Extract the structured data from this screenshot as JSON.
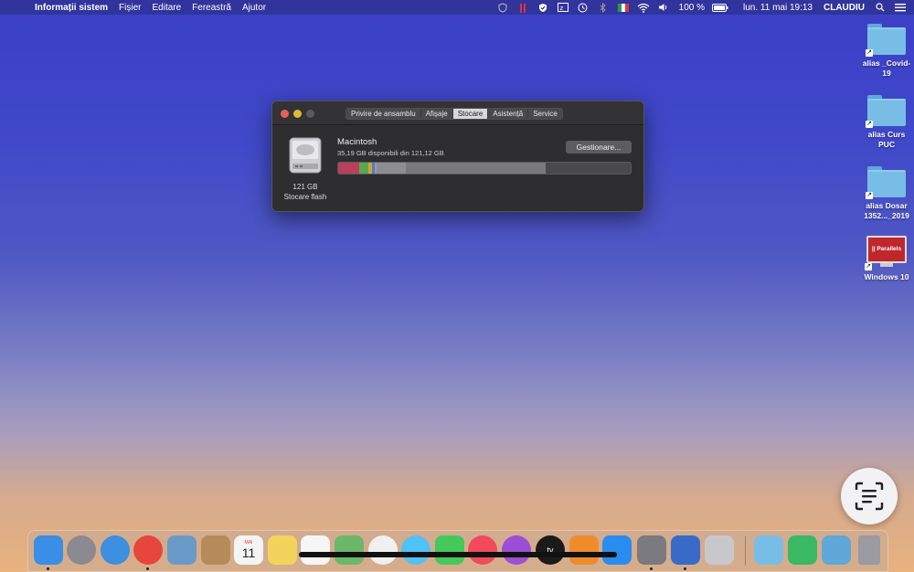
{
  "menubar": {
    "app_name": "Informații sistem",
    "items": [
      "Fișier",
      "Editare",
      "Fereastră",
      "Ajutor"
    ],
    "battery": "100 %",
    "datetime": "lun. 11 mai  19:13",
    "user": "CLAUDIU"
  },
  "window": {
    "tabs": [
      {
        "label": "Privire de ansamblu",
        "active": false
      },
      {
        "label": "Afișaje",
        "active": false
      },
      {
        "label": "Stocare",
        "active": true
      },
      {
        "label": "Asistență",
        "active": false
      },
      {
        "label": "Service",
        "active": false
      }
    ],
    "disk": {
      "name": "Macintosh",
      "free_text": "35,19 GB disponibili din 121,12 GB",
      "size": "121 GB",
      "type": "Stocare flash",
      "manage_label": "Gestionare..."
    },
    "storage_segments": [
      {
        "fraction": 0.072,
        "color": "#b8405e"
      },
      {
        "fraction": 0.032,
        "color": "#5aa84e"
      },
      {
        "fraction": 0.012,
        "color": "#d4a23c"
      },
      {
        "fraction": 0.008,
        "color": "#4d7fd4"
      },
      {
        "fraction": 0.006,
        "color": "#9a9a9c"
      },
      {
        "fraction": 0.1,
        "color": "#8e8e92"
      },
      {
        "fraction": 0.48,
        "color": "#7a7a7e"
      }
    ]
  },
  "desktop": {
    "items": [
      {
        "label": "alias _Covid-19",
        "type": "folder"
      },
      {
        "label": "alias Curs PUC",
        "type": "folder"
      },
      {
        "label": "alias Dosar 1352..._2019",
        "type": "folder"
      },
      {
        "label": "Windows 10",
        "type": "parallels",
        "badge": "|| Parallels"
      }
    ]
  },
  "dock": {
    "apps": [
      {
        "name": "finder",
        "color": "#3a8ee6"
      },
      {
        "name": "launchpad",
        "color": "#8a8a90"
      },
      {
        "name": "safari",
        "color": "#3d8fe0"
      },
      {
        "name": "chrome",
        "color": "#e8453c"
      },
      {
        "name": "preview",
        "color": "#6a9ac8"
      },
      {
        "name": "contacts",
        "color": "#b58b5a"
      },
      {
        "name": "calendar",
        "color": "#f4f4f4"
      },
      {
        "name": "notes",
        "color": "#f2d45c"
      },
      {
        "name": "reminders",
        "color": "#f6f6f6"
      },
      {
        "name": "maps",
        "color": "#6bb86a"
      },
      {
        "name": "photos",
        "color": "#f0f0f0"
      },
      {
        "name": "messages",
        "color": "#4fc2f7"
      },
      {
        "name": "facetime",
        "color": "#42c95a"
      },
      {
        "name": "music",
        "color": "#f04a5c"
      },
      {
        "name": "podcasts",
        "color": "#9b4fd6"
      },
      {
        "name": "apple-tv",
        "color": "#1a1a1a"
      },
      {
        "name": "books",
        "color": "#f08b2c"
      },
      {
        "name": "app-store",
        "color": "#2a8cf0"
      },
      {
        "name": "system-preferences",
        "color": "#7a7a80"
      },
      {
        "name": "parallels",
        "color": "#3a6ac8"
      },
      {
        "name": "utility",
        "color": "#c8c8cc"
      }
    ],
    "right": [
      {
        "name": "downloads-folder",
        "color": "#78bde6"
      },
      {
        "name": "security-shield",
        "color": "#3ab864"
      },
      {
        "name": "documents-folder",
        "color": "#5fa8d9"
      },
      {
        "name": "trash",
        "color": "#9a9aa0"
      }
    ],
    "calendar_month": "MAI",
    "calendar_day": "11",
    "tv_label": "tv"
  }
}
